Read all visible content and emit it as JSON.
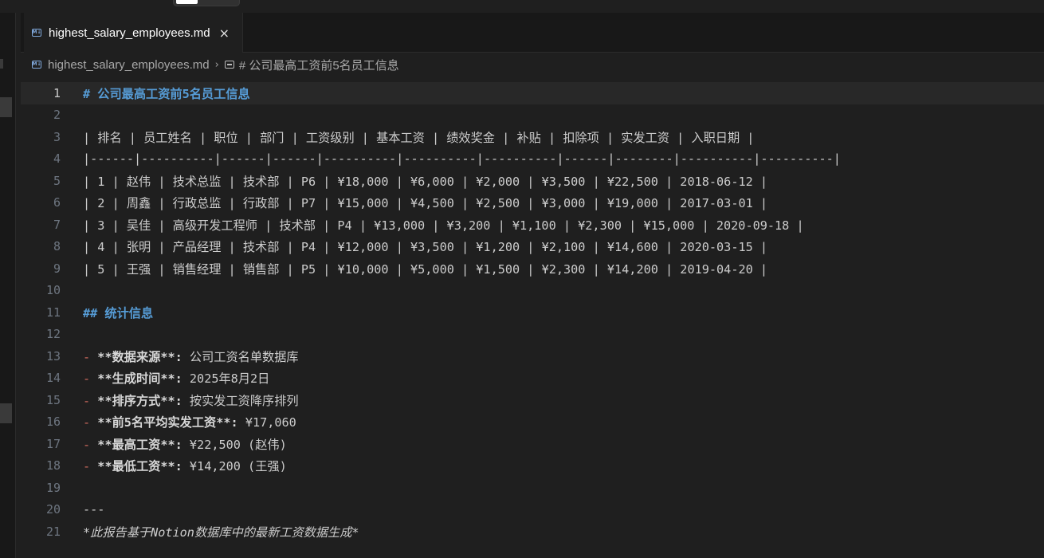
{
  "tab": {
    "title": "highest_salary_employees.md",
    "close": "×",
    "file_icon": "markdown-icon"
  },
  "breadcrumb": {
    "file": "highest_salary_employees.md",
    "separator": "›",
    "symbol": "# 公司最高工资前5名员工信息"
  },
  "editor": {
    "current_line": 1,
    "lines": [
      {
        "n": "1",
        "kind": "heading",
        "text": "# 公司最高工资前5名员工信息"
      },
      {
        "n": "2",
        "kind": "blank",
        "text": ""
      },
      {
        "n": "3",
        "kind": "plain",
        "text": "| 排名 | 员工姓名 | 职位 | 部门 | 工资级别 | 基本工资 | 绩效奖金 | 补贴 | 扣除项 | 实发工资 | 入职日期 |"
      },
      {
        "n": "4",
        "kind": "plain",
        "text": "|------|----------|------|------|----------|----------|----------|------|--------|----------|----------|"
      },
      {
        "n": "5",
        "kind": "plain",
        "text": "| 1 | 赵伟 | 技术总监 | 技术部 | P6 | ¥18,000 | ¥6,000 | ¥2,000 | ¥3,500 | ¥22,500 | 2018-06-12 |"
      },
      {
        "n": "6",
        "kind": "plain",
        "text": "| 2 | 周鑫 | 行政总监 | 行政部 | P7 | ¥15,000 | ¥4,500 | ¥2,500 | ¥3,000 | ¥19,000 | 2017-03-01 |"
      },
      {
        "n": "7",
        "kind": "plain",
        "text": "| 3 | 吴佳 | 高级开发工程师 | 技术部 | P4 | ¥13,000 | ¥3,200 | ¥1,100 | ¥2,300 | ¥15,000 | 2020-09-18 |"
      },
      {
        "n": "8",
        "kind": "plain",
        "text": "| 4 | 张明 | 产品经理 | 技术部 | P4 | ¥12,000 | ¥3,500 | ¥1,200 | ¥2,100 | ¥14,600 | 2020-03-15 |"
      },
      {
        "n": "9",
        "kind": "plain",
        "text": "| 5 | 王强 | 销售经理 | 销售部 | P5 | ¥10,000 | ¥5,000 | ¥1,500 | ¥2,300 | ¥14,200 | 2019-04-20 |"
      },
      {
        "n": "10",
        "kind": "blank",
        "text": ""
      },
      {
        "n": "11",
        "kind": "heading",
        "text": "## 统计信息"
      },
      {
        "n": "12",
        "kind": "blank",
        "text": ""
      },
      {
        "n": "13",
        "kind": "bullet",
        "bold": "**数据来源**:",
        "rest": " 公司工资名单数据库"
      },
      {
        "n": "14",
        "kind": "bullet",
        "bold": "**生成时间**:",
        "rest": " 2025年8月2日"
      },
      {
        "n": "15",
        "kind": "bullet",
        "bold": "**排序方式**:",
        "rest": " 按实发工资降序排列"
      },
      {
        "n": "16",
        "kind": "bullet",
        "bold": "**前5名平均实发工资**:",
        "rest": " ¥17,060"
      },
      {
        "n": "17",
        "kind": "bullet",
        "bold": "**最高工资**:",
        "rest": " ¥22,500 (赵伟)"
      },
      {
        "n": "18",
        "kind": "bullet",
        "bold": "**最低工资**:",
        "rest": " ¥14,200 (王强)"
      },
      {
        "n": "19",
        "kind": "blank",
        "text": ""
      },
      {
        "n": "20",
        "kind": "hr",
        "text": "---"
      },
      {
        "n": "21",
        "kind": "italic",
        "text": "*此报告基于Notion数据库中的最新工资数据生成*"
      }
    ]
  },
  "colors": {
    "background": "#1f1f1f",
    "heading": "#569cd6",
    "list_marker": "#ce6a5e",
    "line_number": "#6e7681"
  }
}
